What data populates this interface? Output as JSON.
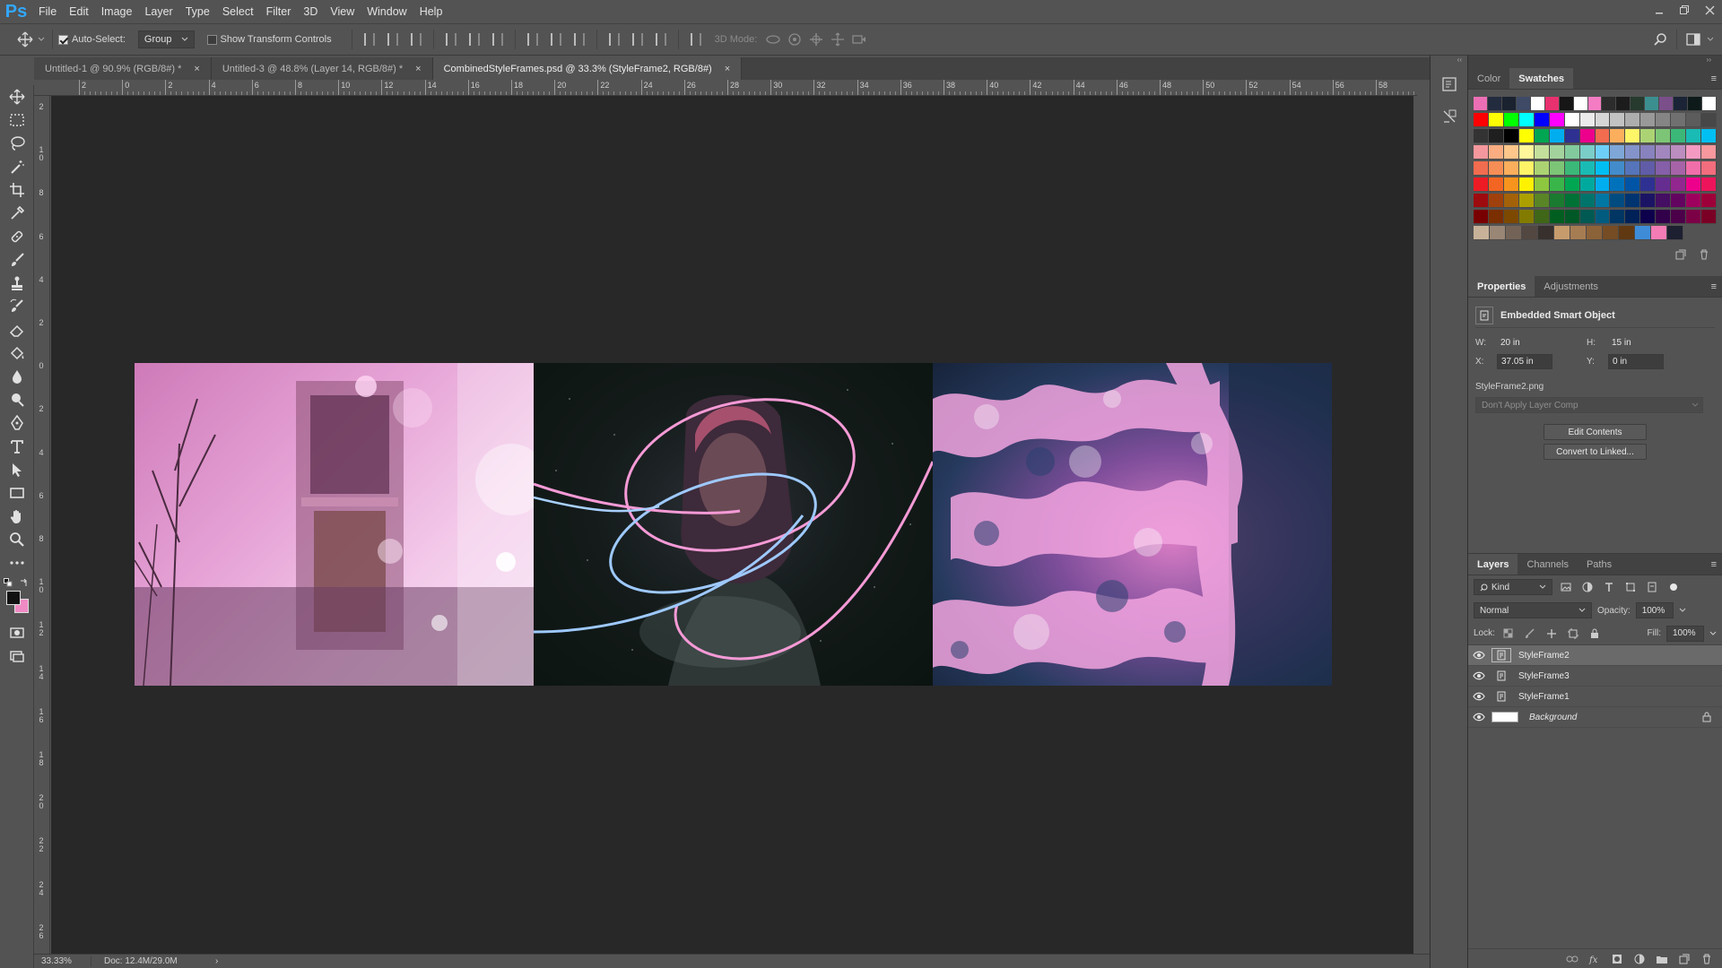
{
  "app": {
    "logo": "Ps"
  },
  "menu": [
    "File",
    "Edit",
    "Image",
    "Layer",
    "Type",
    "Select",
    "Filter",
    "3D",
    "View",
    "Window",
    "Help"
  ],
  "options": {
    "auto_select_label": "Auto-Select:",
    "auto_select_checked": true,
    "auto_select_value": "Group",
    "transform_label": "Show Transform Controls",
    "transform_checked": false,
    "mode_3d_label": "3D Mode:"
  },
  "tabs": [
    {
      "label": "Untitled-1 @ 90.9% (RGB/8#) *",
      "close": "×",
      "active": false
    },
    {
      "label": "Untitled-3 @ 48.8% (Layer 14, RGB/8#) *",
      "close": "×",
      "active": false
    },
    {
      "label": "CombinedStyleFrames.psd @ 33.3% (StyleFrame2, RGB/8#)",
      "close": "×",
      "active": true
    }
  ],
  "ruler_top": [
    "2",
    "0",
    "2",
    "4",
    "6",
    "8",
    "10",
    "12",
    "14",
    "16",
    "18",
    "20",
    "22",
    "24",
    "26",
    "28",
    "30",
    "32",
    "34",
    "36",
    "38",
    "40",
    "42",
    "44",
    "46",
    "48",
    "50",
    "52",
    "54",
    "56",
    "58"
  ],
  "ruler_left": [
    "2",
    "1 0",
    "8",
    "6",
    "4",
    "2",
    "0",
    "2",
    "4",
    "6",
    "8",
    "1 0",
    "1 2",
    "1 4",
    "1 6",
    "1 8",
    "2 0",
    "2 2",
    "2 4",
    "2 6"
  ],
  "status": {
    "zoom": "33.33%",
    "doc": "Doc: 12.4M/29.0M",
    "arrow": "›"
  },
  "swatch_panel": {
    "tab_color": "Color",
    "tab_swatches": "Swatches",
    "menu": "≡"
  },
  "swatch_colors": [
    [
      "#ec6fb5",
      "#232b3f",
      "#1a2230",
      "#3e4a66",
      "#ffffff",
      "#e8316f",
      "#161616",
      "#ffffff",
      "#f47cc3",
      "#2c2c2c",
      "#1c1c1c",
      "#263a2e",
      "#3c8f8f",
      "#7a4f8a",
      "#1a2436",
      "#0e1a1a",
      "#ffffff"
    ],
    [
      "#ff0000",
      "#ffff00",
      "#00ff00",
      "#00ffff",
      "#0000ff",
      "#ff00ff",
      "#ffffff",
      "#ebebeb",
      "#d6d6d6",
      "#c2c2c2",
      "#adadad",
      "#999999",
      "#858585",
      "#707070",
      "#5c5c5c",
      "#474747"
    ],
    [
      "#333333",
      "#1f1f1f",
      "#000000",
      "#ffff00",
      "#00a651",
      "#00aeef",
      "#2e3192",
      "#ec008c",
      "#f26c4f",
      "#fbaf5d",
      "#fff568",
      "#acd373",
      "#7cc576",
      "#3bb878",
      "#1abbb4",
      "#00bff3"
    ],
    [
      "#f5989d",
      "#f9ad81",
      "#fdc68a",
      "#fff79a",
      "#c4df9b",
      "#a3d39c",
      "#82ca9d",
      "#7bcdc8",
      "#6ecff6",
      "#7ea7d8",
      "#8493ca",
      "#8882be",
      "#a187be",
      "#bc8dbf",
      "#f49ac2",
      "#f6989d"
    ],
    [
      "#f26c4f",
      "#f68e55",
      "#fbaf5c",
      "#fff467",
      "#acd372",
      "#7cc576",
      "#3bb878",
      "#1abbb4",
      "#00bef2",
      "#438ccb",
      "#5574b9",
      "#605ca8",
      "#855fa8",
      "#a763a8",
      "#f06ea9",
      "#f26d7d"
    ],
    [
      "#ed1c24",
      "#f26522",
      "#f7941d",
      "#fff200",
      "#8dc63f",
      "#39b54a",
      "#00a651",
      "#00a99d",
      "#00aeef",
      "#0072bc",
      "#0054a6",
      "#2e3192",
      "#662d91",
      "#92278f",
      "#ec008c",
      "#ed145b"
    ],
    [
      "#9e0b0f",
      "#a0410d",
      "#a36209",
      "#aba000",
      "#598527",
      "#1a7b30",
      "#007236",
      "#00746b",
      "#0076a3",
      "#004b80",
      "#003471",
      "#1b1464",
      "#440e62",
      "#630460",
      "#9e005d",
      "#9e0039"
    ],
    [
      "#790000",
      "#7b2e00",
      "#7d4900",
      "#827b00",
      "#406618",
      "#005e20",
      "#005826",
      "#005952",
      "#005b7f",
      "#003663",
      "#002157",
      "#0d004c",
      "#32004b",
      "#4b0049",
      "#7b0046",
      "#7a0026"
    ],
    [
      "#c7b299",
      "#998675",
      "#736357",
      "#534741",
      "#37302d",
      "#c69c6d",
      "#a67c52",
      "#8c6239",
      "#754c24",
      "#603913",
      "#3e8cd8",
      "#f37cb5",
      "#1d2030"
    ]
  ],
  "properties": {
    "tab_properties": "Properties",
    "tab_adjustments": "Adjustments",
    "menu": "≡",
    "title": "Embedded Smart Object",
    "w_label": "W:",
    "w_value": "20 in",
    "h_label": "H:",
    "h_value": "15 in",
    "x_label": "X:",
    "x_value": "37.05 in",
    "y_label": "Y:",
    "y_value": "0 in",
    "file_name": "StyleFrame2.png",
    "layer_comp": "Don't Apply Layer Comp",
    "edit_contents": "Edit Contents",
    "convert": "Convert to Linked..."
  },
  "layers_panel": {
    "tab_layers": "Layers",
    "tab_channels": "Channels",
    "tab_paths": "Paths",
    "menu": "≡",
    "kind": "Kind",
    "blend": "Normal",
    "opacity_label": "Opacity:",
    "opacity_value": "100%",
    "lock_label": "Lock:",
    "fill_label": "Fill:",
    "fill_value": "100%",
    "layers": [
      {
        "name": "StyleFrame2",
        "selected": true
      },
      {
        "name": "StyleFrame3",
        "selected": false
      },
      {
        "name": "StyleFrame1",
        "selected": false
      },
      {
        "name": "Background",
        "selected": false
      }
    ]
  }
}
